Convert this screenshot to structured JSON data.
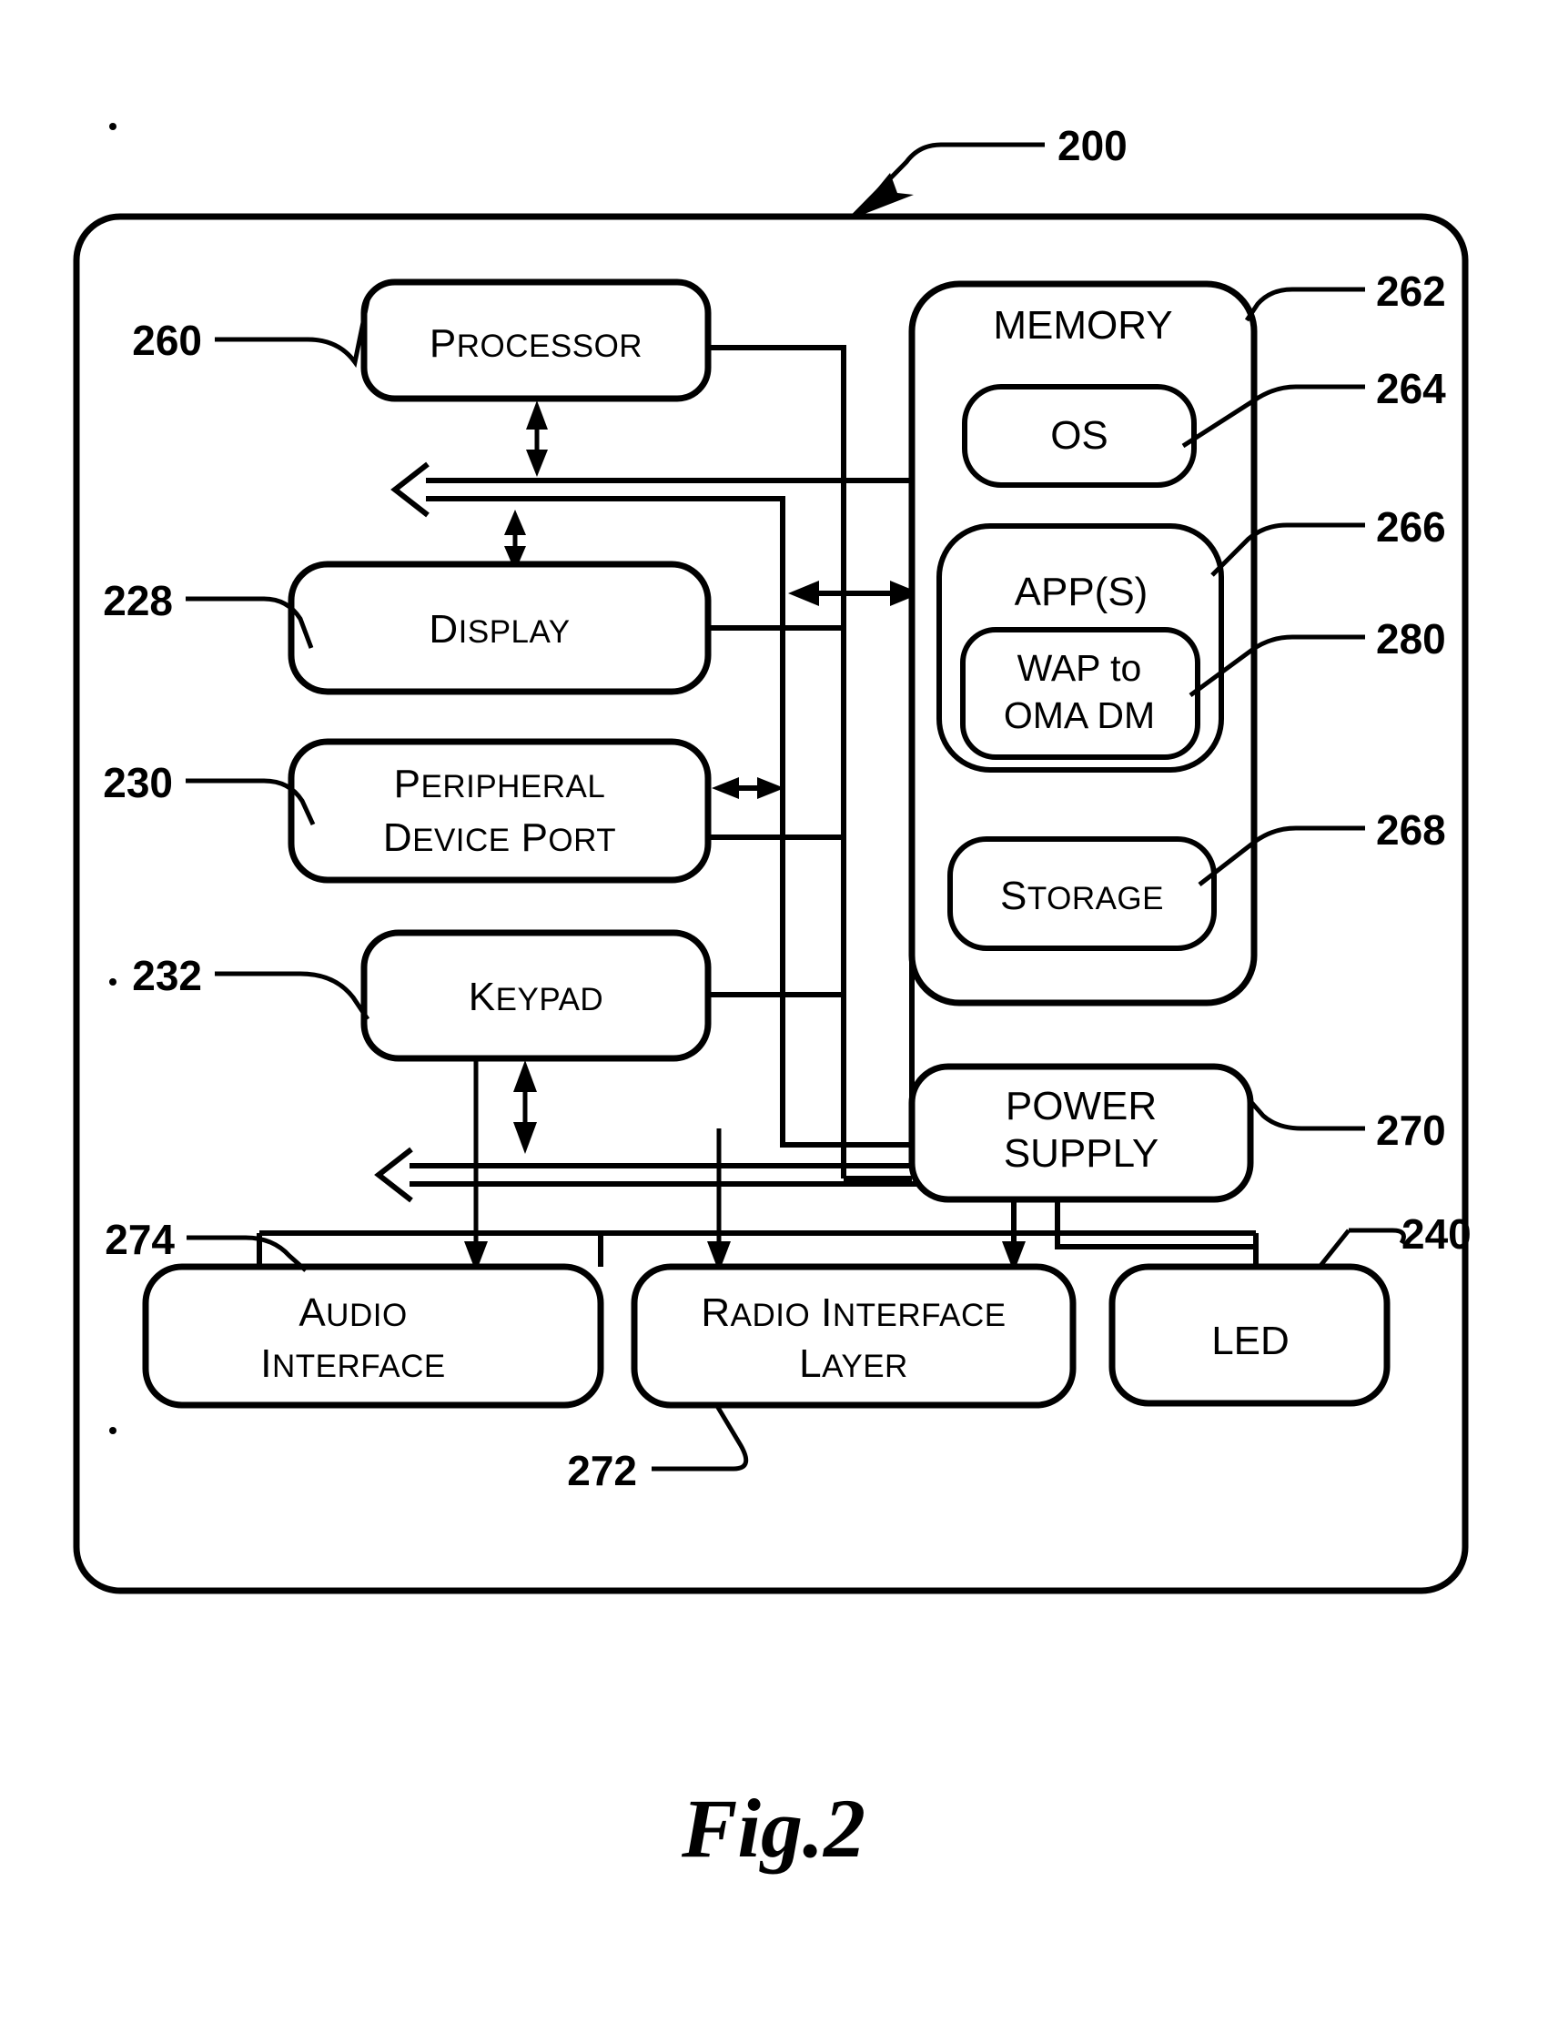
{
  "figure": {
    "caption": "Fig.2",
    "device_ref": "200"
  },
  "blocks": {
    "processor": {
      "label": "Processor",
      "ref": "260"
    },
    "display": {
      "label": "Display",
      "ref": "228"
    },
    "peripheral_port": {
      "label_line1": "Peripheral",
      "label_line2": "Device Port",
      "ref": "230"
    },
    "keypad": {
      "label": "Keypad",
      "ref": "232"
    },
    "memory": {
      "label": "MEMORY",
      "ref": "262"
    },
    "os": {
      "label": "OS",
      "ref": "264"
    },
    "apps": {
      "label": "APP(S)",
      "ref": "266"
    },
    "wap_to_oma_dm": {
      "label_line1": "WAP to",
      "label_line2": "OMA DM",
      "ref": "280"
    },
    "storage": {
      "label": "Storage",
      "ref": "268"
    },
    "power_supply": {
      "label_line1": "POWER",
      "label_line2": "SUPPLY",
      "ref": "270"
    },
    "audio_interface": {
      "label_line1": "Audio",
      "label_line2": "Interface",
      "ref": "274"
    },
    "radio_interface": {
      "label_line1": "Radio Interface",
      "label_line2": "Layer",
      "ref": "272"
    },
    "led": {
      "label": "LED",
      "ref": "240"
    }
  },
  "colors": {
    "ink": "#000000",
    "paper": "#ffffff"
  }
}
